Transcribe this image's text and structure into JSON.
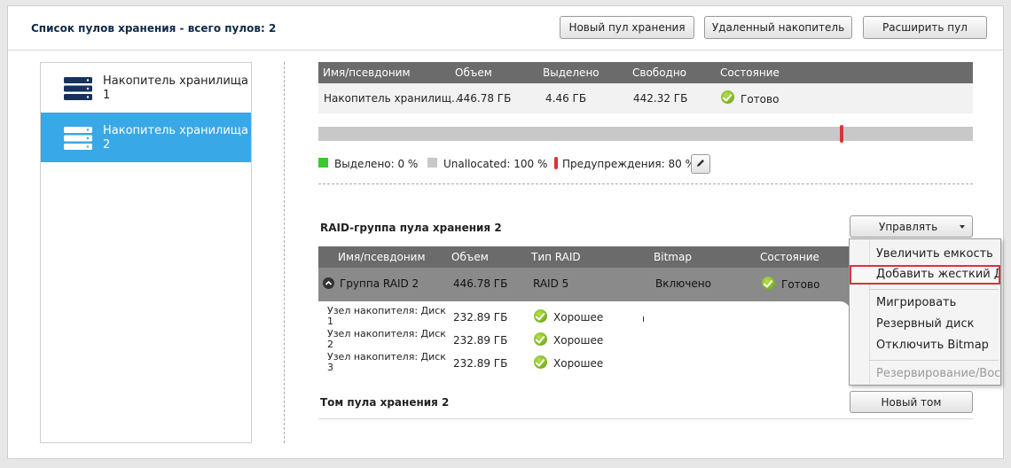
{
  "header": {
    "title": "Список пулов хранения - всего пулов: 2",
    "buttons": {
      "new_pool": "Новый пул хранения",
      "removed_drive": "Удаленный накопитель",
      "expand_pool": "Расширить пул"
    }
  },
  "sidebar": {
    "items": [
      {
        "label": "Накопитель хранилища 1",
        "icon": "storage-server-icon"
      },
      {
        "label": "Накопитель хранилища 2",
        "icon": "storage-server-icon"
      }
    ]
  },
  "pool_table": {
    "headers": [
      "Имя/псевдоним",
      "Объем",
      "Выделено",
      "Свободно",
      "Состояние"
    ],
    "row": {
      "name": "Накопитель хранилищ...",
      "size": "446.78 ГБ",
      "allocated": "4.46 ГБ",
      "free": "442.32 ГБ",
      "status": "Готово"
    }
  },
  "usage_bar": {
    "allocated_fraction": 0.0,
    "warning_threshold_fraction": 0.8
  },
  "legend": {
    "allocated": "Выделено: 0 %",
    "unallocated": "Unallocated: 100 %",
    "warnings": "Предупреждения: 80 %"
  },
  "raid_section": {
    "title": "RAID-группа пула хранения 2",
    "manage_label": "Управлять",
    "headers": [
      "Имя/псевдоним",
      "Объем",
      "Тип RAID",
      "Bitmap",
      "Состояние"
    ],
    "group": {
      "name": "Группа RAID 2",
      "size": "446.78 ГБ",
      "raid_type": "RAID 5",
      "bitmap": "Включено",
      "status": "Готово"
    },
    "disks": [
      {
        "name": "Узел накопителя: Диск 1",
        "size": "232.89 ГБ",
        "status": "Хорошее"
      },
      {
        "name": "Узел накопителя: Диск 2",
        "size": "232.89 ГБ",
        "status": "Хорошее"
      },
      {
        "name": "Узел накопителя: Диск 3",
        "size": "232.89 ГБ",
        "status": "Хорошее"
      }
    ]
  },
  "manage_menu": {
    "items": [
      {
        "label": "Увеличить емкость",
        "enabled": true
      },
      {
        "label": "Добавить жесткий Д",
        "enabled": true,
        "highlighted": true
      },
      {
        "label": "Мигрировать",
        "enabled": true
      },
      {
        "label": "Резервный диск",
        "enabled": true
      },
      {
        "label": "Отключить Bitmap",
        "enabled": true
      },
      {
        "label": "Резервирование/Восс",
        "enabled": false
      }
    ]
  },
  "volume_section": {
    "title": "Том пула хранения 2",
    "new_volume_label": "Новый том"
  },
  "colors": {
    "accent": "#39a8e6",
    "header_gray": "#6b6b6b",
    "allocated": "#3ec832",
    "unallocated": "#c8c8c8",
    "warning": "#d9343a"
  }
}
